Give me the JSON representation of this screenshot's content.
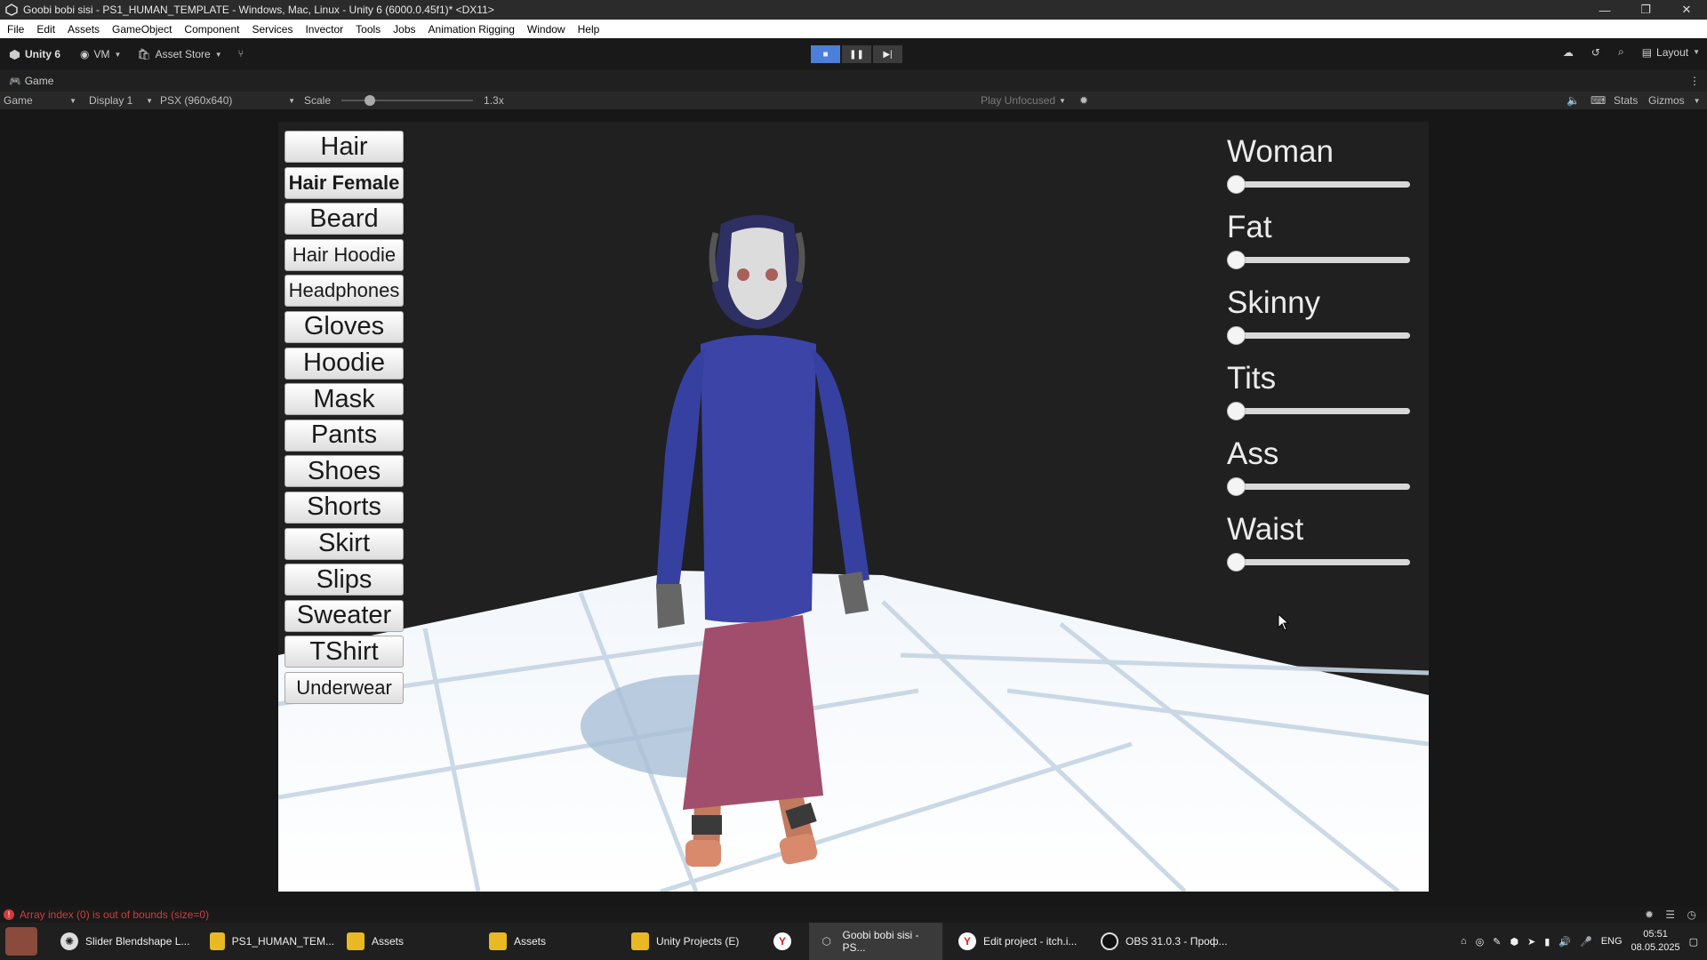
{
  "window": {
    "title": "Goobi bobi sisi - PS1_HUMAN_TEMPLATE - Windows, Mac, Linux - Unity 6 (6000.0.45f1)* <DX11>",
    "controls": [
      "—",
      "❐",
      "✕"
    ]
  },
  "menu": [
    "File",
    "Edit",
    "Assets",
    "GameObject",
    "Component",
    "Services",
    "Invector",
    "Tools",
    "Jobs",
    "Animation Rigging",
    "Window",
    "Help"
  ],
  "toolbar": {
    "unity_label": "Unity 6",
    "account_label": "VM",
    "asset_store_label": "Asset Store",
    "layout_label": "Layout"
  },
  "tab": {
    "label": "Game"
  },
  "game_toolbar": {
    "mode": "Game",
    "display": "Display 1",
    "resolution": "PSX (960x640)",
    "scale_label": "Scale",
    "scale_value": "1.3x",
    "play_mode": "Play Unfocused",
    "stats": "Stats",
    "gizmos": "Gizmos"
  },
  "game": {
    "buttons": [
      "Hair",
      "Hair Female",
      "Beard",
      "Hair Hoodie",
      "Headphones",
      "Gloves",
      "Hoodie",
      "Mask",
      "Pants",
      "Shoes",
      "Shorts",
      "Skirt",
      "Slips",
      "Sweater",
      "TShirt",
      "Underwear"
    ],
    "sliders": [
      {
        "label": "Woman",
        "value": 0
      },
      {
        "label": "Fat",
        "value": 0
      },
      {
        "label": "Skinny",
        "value": 0
      },
      {
        "label": "Tits",
        "value": 0
      },
      {
        "label": "Ass",
        "value": 0
      },
      {
        "label": "Waist",
        "value": 0
      }
    ]
  },
  "status": {
    "error": "Array index (0) is out of bounds (size=0)"
  },
  "taskbar": {
    "items": [
      "Slider Blendshape L...",
      "PS1_HUMAN_TEM...",
      "Assets",
      "Assets",
      "Unity Projects (E)",
      "",
      "Goobi bobi sisi - PS...",
      "Edit project - itch.i...",
      "OBS 31.0.3 - Проф..."
    ],
    "lang": "ENG",
    "time": "05:51",
    "date": "08.05.2025"
  },
  "colors": {
    "accent": "#4c7fd9",
    "error": "#d23b3b",
    "sweater": "#3c44a8",
    "skirt": "#a8506e"
  }
}
